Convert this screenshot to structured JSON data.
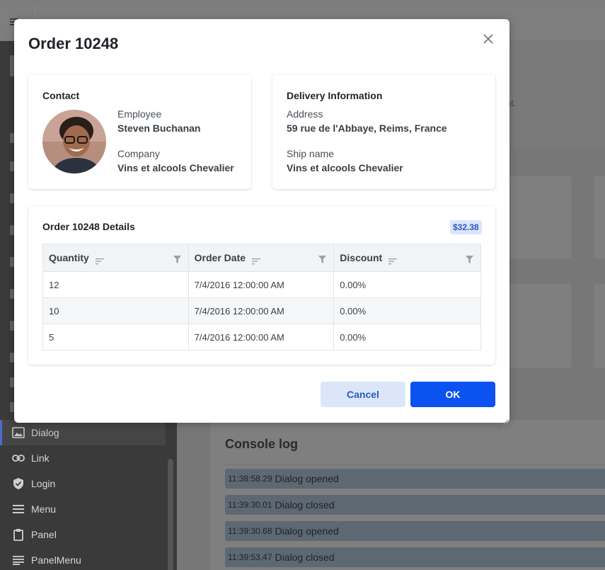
{
  "modal": {
    "title": "Order 10248",
    "contact": {
      "title": "Contact",
      "employee_label": "Employee",
      "employee_value": "Steven Buchanan",
      "company_label": "Company",
      "company_value": "Vins et alcools Chevalier"
    },
    "delivery": {
      "title": "Delivery Information",
      "address_label": "Address",
      "address_value": "59 rue de l'Abbaye, Reims, France",
      "ship_label": "Ship name",
      "ship_value": "Vins et alcools Chevalier"
    },
    "details": {
      "title": "Order 10248 Details",
      "price": "$32.38",
      "columns": [
        "Quantity",
        "Order Date",
        "Discount"
      ],
      "rows": [
        [
          "12",
          "7/4/2016 12:00:00 AM",
          "0.00%"
        ],
        [
          "10",
          "7/4/2016 12:00:00 AM",
          "0.00%"
        ],
        [
          "5",
          "7/4/2016 12:00:00 AM",
          "0.00%"
        ]
      ]
    },
    "cancel_label": "Cancel",
    "ok_label": "OK"
  },
  "sidebar": {
    "items": [
      {
        "label": "Dialog",
        "icon": "image-icon"
      },
      {
        "label": "Link",
        "icon": "link-icon"
      },
      {
        "label": "Login",
        "icon": "shield-check-icon"
      },
      {
        "label": "Menu",
        "icon": "menu-icon"
      },
      {
        "label": "Panel",
        "icon": "clipboard-icon"
      },
      {
        "label": "PanelMenu",
        "icon": "list-icon"
      }
    ]
  },
  "banner": {
    "text_fragment": "nt."
  },
  "console": {
    "title": "Console log",
    "entries": [
      {
        "time": "11:38:58.29",
        "message": "Dialog opened"
      },
      {
        "time": "11:39:30.01",
        "message": "Dialog closed"
      },
      {
        "time": "11:39:30.68",
        "message": "Dialog opened"
      },
      {
        "time": "11:39:53.47",
        "message": "Dialog closed"
      }
    ]
  },
  "colors": {
    "primary": "#0b52f0",
    "accent_light": "#dce6fb",
    "overlay": "#7d7d7d"
  }
}
